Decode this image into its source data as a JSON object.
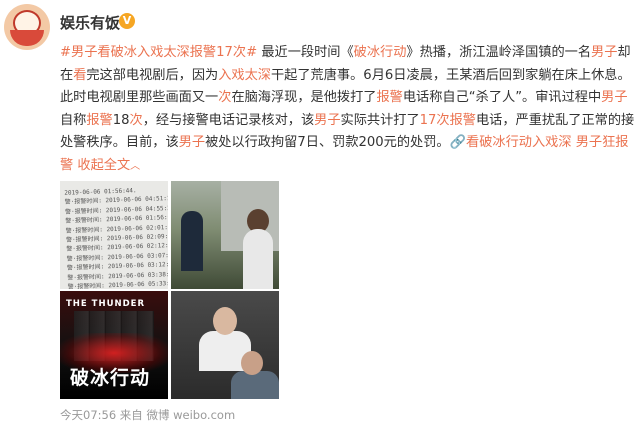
{
  "account": {
    "name": "娱乐有饭",
    "verified_badge": "V",
    "avatar_label": "娱乐有饭"
  },
  "post": {
    "p": [
      {
        "t": "#男子看破冰入戏太深报警17次#",
        "c": "lk"
      },
      {
        "t": " 最近一段时间《",
        "c": ""
      },
      {
        "t": "破冰行动",
        "c": "hl"
      },
      {
        "t": "》热播，浙江温岭泽国镇的一名",
        "c": ""
      },
      {
        "t": "男子",
        "c": "hl"
      },
      {
        "t": "却在",
        "c": ""
      },
      {
        "t": "看",
        "c": "hl"
      },
      {
        "t": "完这部电视剧后，因为",
        "c": ""
      },
      {
        "t": "入戏太深",
        "c": "hl"
      },
      {
        "t": "干起了荒唐事。6月6日凌晨，王某酒后回到家躺在床上休息。此时电视剧里那些画面又一",
        "c": ""
      },
      {
        "t": "次",
        "c": "hl"
      },
      {
        "t": "在脑海浮现，是他拨打了",
        "c": ""
      },
      {
        "t": "报警",
        "c": "hl"
      },
      {
        "t": "电话称自己“杀了人”。审讯过程中",
        "c": ""
      },
      {
        "t": "男子",
        "c": "hl"
      },
      {
        "t": "自称",
        "c": ""
      },
      {
        "t": "报警",
        "c": "hl"
      },
      {
        "t": "18",
        "c": ""
      },
      {
        "t": "次",
        "c": "hl"
      },
      {
        "t": "，经与接警电话记录核对，该",
        "c": ""
      },
      {
        "t": "男子",
        "c": "hl"
      },
      {
        "t": "实际共计打了",
        "c": ""
      },
      {
        "t": "17次报警",
        "c": "hl"
      },
      {
        "t": "电话，严重扰乱了正常的接处警秩序。目前，该",
        "c": ""
      },
      {
        "t": "男子",
        "c": "hl"
      },
      {
        "t": "被处以行政拘留7日、罚款200元的处罚。",
        "c": ""
      },
      {
        "t": "🔗看破冰行动入戏深 男子狂报警",
        "c": "lk"
      },
      {
        "t": " 收起全文",
        "c": "lk"
      }
    ],
    "collapse_caret": "︿"
  },
  "images": {
    "t1_text": "2019-06-06 01:56:44.\n警·报警时间: 2019-06-06 04:51:16\n警·报警时间: 2019-06-06 04:55:36\n警·报警时间: 2019-06-06 01:56:0\n警·报警时间: 2019-06-06 02:01:06\n警·报警时间: 2019-06-06 02:09:40\n警·报警时间: 2019-06-06 02:12:37\n警·报警时间: 2019-06-06 03:07:25\n警·报警时间: 2019-06-06 03:12:01\n警·报警时间: 2019-06-06 03:38:51\n警·报警时间: 2019-06-06 05:33:29",
    "t3_title": "THE THUNDER",
    "t3_big": "破冰行动"
  },
  "meta": {
    "time": "今天07:56",
    "from": " 来自 ",
    "source": "微博 weibo.com"
  }
}
